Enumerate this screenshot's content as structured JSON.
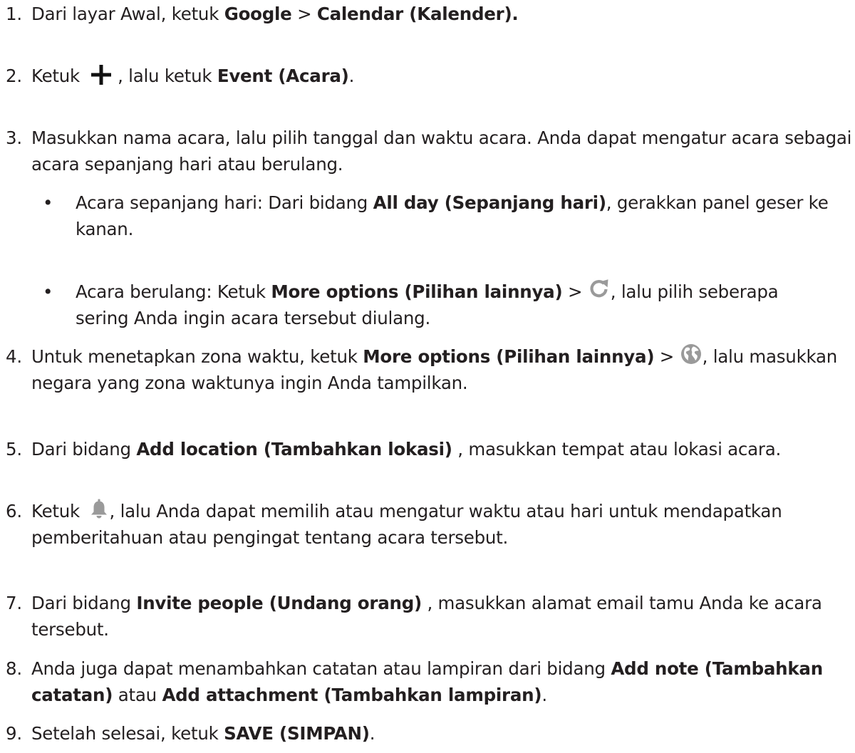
{
  "colors": {
    "text": "#231f20",
    "icon_plus": "#111111",
    "icon_gray": "#9a9a9a"
  },
  "steps": [
    {
      "num": "1.",
      "t1": "Dari layar Awal, ketuk ",
      "b1": "Google",
      "t2": " > ",
      "b2": "Calendar (Kalender)."
    },
    {
      "num": "2.",
      "t1": "Ketuk ",
      "icon": "plus-icon",
      "t2": " , lalu ketuk ",
      "b1": "Event (Acara)",
      "t3": "."
    },
    {
      "num": "3.",
      "t1": "Masukkan nama acara, lalu pilih tanggal dan waktu acara. Anda dapat mengatur acara sebagai acara sepanjang hari atau berulang."
    },
    {
      "num": "4.",
      "t1": "Untuk menetapkan zona waktu, ketuk ",
      "b1": "More options (Pilihan lainnya)",
      "t2": " > ",
      "icon": "globe-icon",
      "t3": ", lalu masukkan negara yang zona waktunya ingin Anda tampilkan."
    },
    {
      "num": "5.",
      "t1": "Dari bidang ",
      "b1": "Add location (Tambahkan lokasi)",
      "t2": " , masukkan tempat atau lokasi acara."
    },
    {
      "num": "6.",
      "t1": "Ketuk ",
      "icon": "bell-icon",
      "t2": ", lalu Anda dapat memilih atau mengatur waktu atau hari untuk mendapatkan pemberitahuan atau pengingat tentang acara tersebut."
    },
    {
      "num": "7.",
      "t1": "Dari bidang ",
      "b1": "Invite people (Undang orang)",
      "t2": " , masukkan alamat email tamu Anda ke acara tersebut."
    },
    {
      "num": "8.",
      "t1": "Anda juga dapat menambahkan catatan atau lampiran dari bidang ",
      "b1": "Add note (Tambahkan catatan)",
      "t2": " atau ",
      "b2": "Add attachment (Tambahkan lampiran)",
      "t3": "."
    },
    {
      "num": "9.",
      "t1": "Setelah selesai, ketuk ",
      "b1": "SAVE (SIMPAN)",
      "t2": "."
    }
  ],
  "bullets": [
    {
      "dot": "•",
      "t1": "Acara sepanjang hari: Dari bidang ",
      "b1": "All day (Sepanjang hari)",
      "t2": ", gerakkan panel geser ke kanan."
    },
    {
      "dot": "•",
      "t1": "Acara berulang: Ketuk ",
      "b1": "More options (Pilihan lainnya)",
      "t2": " > ",
      "icon": "repeat-icon",
      "t3": ", lalu pilih seberapa sering Anda ingin acara tersebut diulang."
    }
  ]
}
